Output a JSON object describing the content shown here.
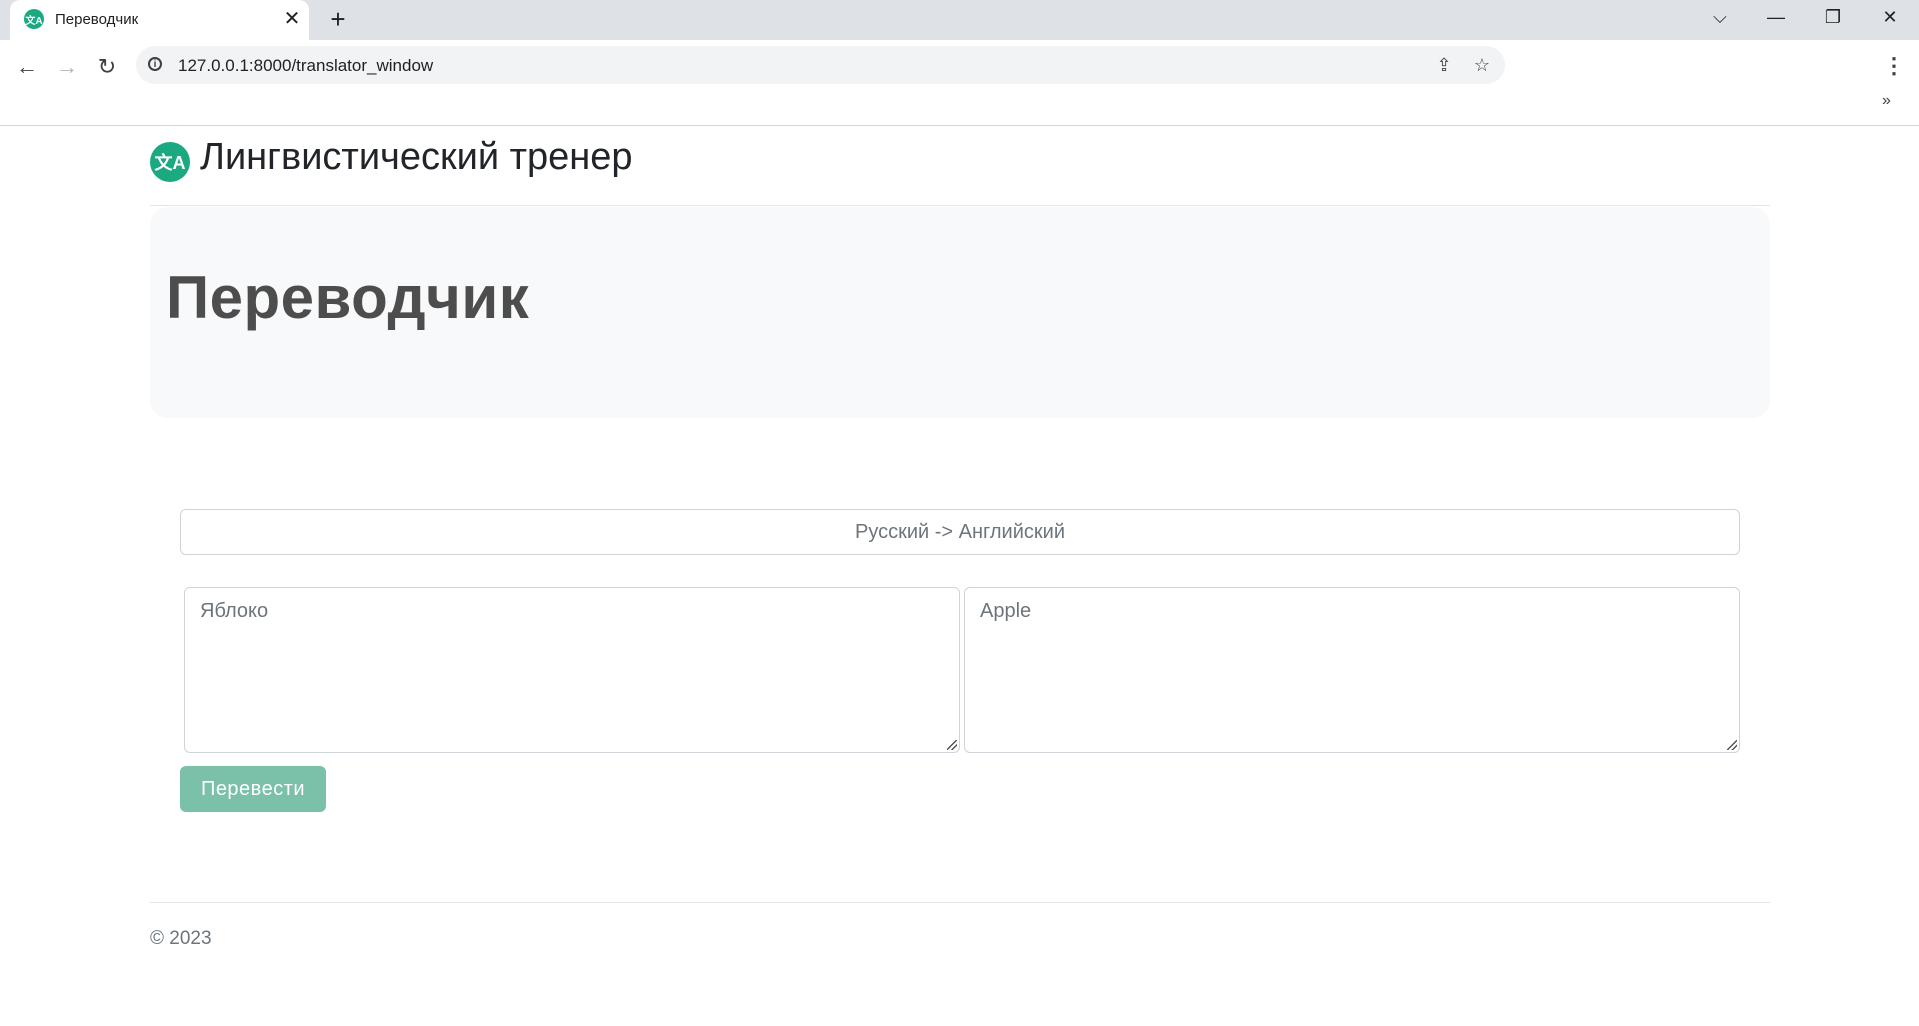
{
  "browser": {
    "tab_title": "Переводчик",
    "tab_favicon": "文A",
    "tab_close_glyph": "✕",
    "new_tab_glyph": "+",
    "window_controls": {
      "tab_search": "⌵",
      "minimize": "—",
      "restore": "❐",
      "close": "✕"
    },
    "nav": {
      "back": "←",
      "forward": "→",
      "reload": "↻"
    },
    "info_glyph": "i",
    "url": "127.0.0.1:8000/translator_window",
    "share_glyph": "⇪",
    "bookmark_glyph": "☆",
    "menu_glyph": "⋮",
    "overflow_glyph": "»"
  },
  "header": {
    "logo_glyph": "文A",
    "brand": "Лингвистический тренер"
  },
  "hero": {
    "title": "Переводчик"
  },
  "translator": {
    "direction": "Русский -> Английский",
    "source_text": "Яблоко",
    "target_text": "Apple",
    "submit_label": "Перевести"
  },
  "footer": {
    "text": "© 2023"
  },
  "colors": {
    "brand": "#1aa980",
    "button": "#7bc0a8",
    "hero_bg": "#f8f9fa"
  },
  "icons": [
    "translate-icon",
    "close-icon",
    "plus-icon",
    "chevron-down-icon",
    "minimize-icon",
    "restore-icon",
    "back-arrow-icon",
    "forward-arrow-icon",
    "reload-icon",
    "info-icon",
    "share-icon",
    "star-icon",
    "kebab-menu-icon",
    "chevron-double-right-icon"
  ]
}
